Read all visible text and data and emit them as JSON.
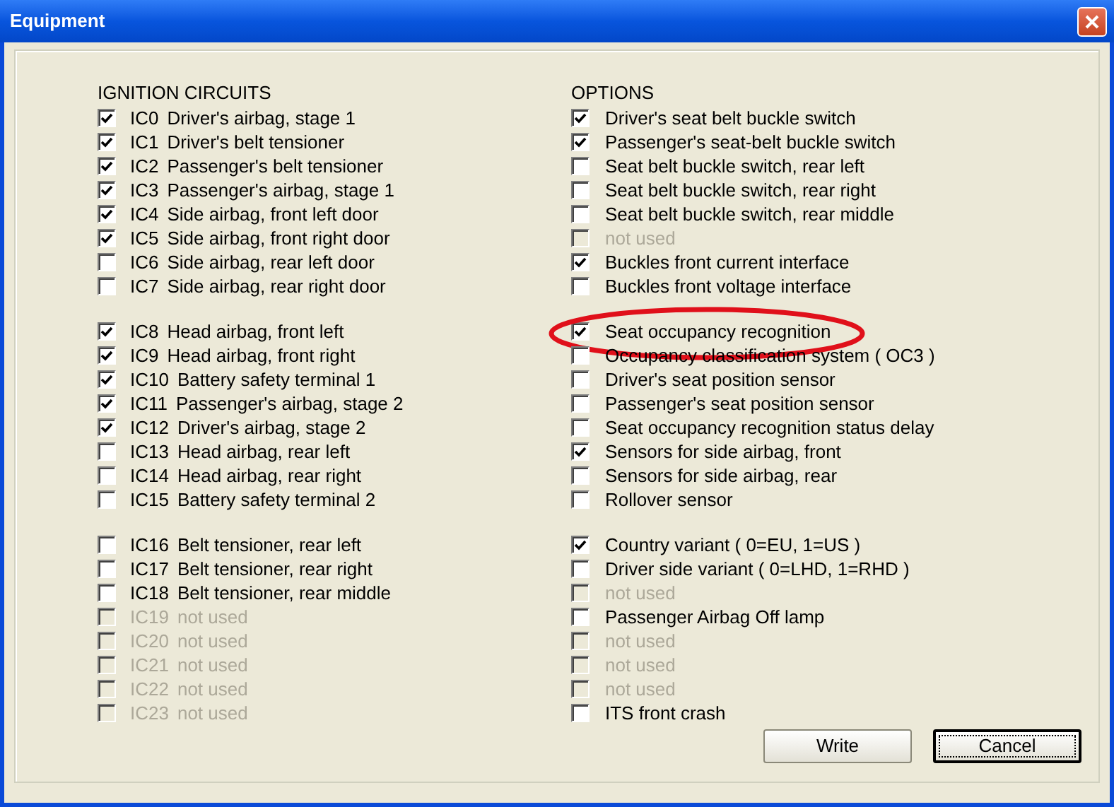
{
  "window": {
    "title": "Equipment"
  },
  "ignition_circuits": {
    "heading": "IGNITION  CIRCUITS",
    "groups": [
      [
        {
          "code": "IC0",
          "label": "Driver's airbag, stage 1",
          "checked": true,
          "disabled": false
        },
        {
          "code": "IC1",
          "label": "Driver's belt tensioner",
          "checked": true,
          "disabled": false
        },
        {
          "code": "IC2",
          "label": "Passenger's belt tensioner",
          "checked": true,
          "disabled": false
        },
        {
          "code": "IC3",
          "label": "Passenger's airbag, stage 1",
          "checked": true,
          "disabled": false
        },
        {
          "code": "IC4",
          "label": "Side airbag, front left door",
          "checked": true,
          "disabled": false
        },
        {
          "code": "IC5",
          "label": "Side airbag, front right door",
          "checked": true,
          "disabled": false
        },
        {
          "code": "IC6",
          "label": "Side airbag, rear left door",
          "checked": false,
          "disabled": false
        },
        {
          "code": "IC7",
          "label": "Side airbag, rear right door",
          "checked": false,
          "disabled": false
        }
      ],
      [
        {
          "code": "IC8",
          "label": "Head airbag, front left",
          "checked": true,
          "disabled": false
        },
        {
          "code": "IC9",
          "label": "Head airbag, front right",
          "checked": true,
          "disabled": false
        },
        {
          "code": "IC10",
          "label": "Battery safety terminal 1",
          "checked": true,
          "disabled": false
        },
        {
          "code": "IC11",
          "label": "Passenger's airbag, stage 2",
          "checked": true,
          "disabled": false
        },
        {
          "code": "IC12",
          "label": "Driver's airbag, stage 2",
          "checked": true,
          "disabled": false
        },
        {
          "code": "IC13",
          "label": "Head airbag, rear left",
          "checked": false,
          "disabled": false
        },
        {
          "code": "IC14",
          "label": "Head airbag, rear right",
          "checked": false,
          "disabled": false
        },
        {
          "code": "IC15",
          "label": "Battery safety terminal 2",
          "checked": false,
          "disabled": false
        }
      ],
      [
        {
          "code": "IC16",
          "label": "Belt tensioner, rear left",
          "checked": false,
          "disabled": false
        },
        {
          "code": "IC17",
          "label": "Belt tensioner, rear right",
          "checked": false,
          "disabled": false
        },
        {
          "code": "IC18",
          "label": "Belt tensioner, rear middle",
          "checked": false,
          "disabled": false
        },
        {
          "code": "IC19",
          "label": "not used",
          "checked": false,
          "disabled": true
        },
        {
          "code": "IC20",
          "label": "not used",
          "checked": false,
          "disabled": true
        },
        {
          "code": "IC21",
          "label": "not used",
          "checked": false,
          "disabled": true
        },
        {
          "code": "IC22",
          "label": "not used",
          "checked": false,
          "disabled": true
        },
        {
          "code": "IC23",
          "label": "not used",
          "checked": false,
          "disabled": true
        }
      ]
    ]
  },
  "options": {
    "heading": "OPTIONS",
    "groups": [
      [
        {
          "label": "Driver's seat belt buckle switch",
          "checked": true,
          "disabled": false,
          "highlighted": false
        },
        {
          "label": "Passenger's seat-belt buckle switch",
          "checked": true,
          "disabled": false,
          "highlighted": false
        },
        {
          "label": "Seat belt buckle switch, rear left",
          "checked": false,
          "disabled": false,
          "highlighted": false
        },
        {
          "label": "Seat belt buckle switch, rear right",
          "checked": false,
          "disabled": false,
          "highlighted": false
        },
        {
          "label": "Seat belt buckle switch, rear middle",
          "checked": false,
          "disabled": false,
          "highlighted": false
        },
        {
          "label": "not used",
          "checked": false,
          "disabled": true,
          "highlighted": false
        },
        {
          "label": "Buckles front current interface",
          "checked": true,
          "disabled": false,
          "highlighted": false
        },
        {
          "label": "Buckles front voltage interface",
          "checked": false,
          "disabled": false,
          "highlighted": false
        }
      ],
      [
        {
          "label": "Seat occupancy recognition",
          "checked": true,
          "disabled": false,
          "highlighted": true
        },
        {
          "label": "Occupancy classification system ( OC3 )",
          "checked": false,
          "disabled": false,
          "highlighted": false
        },
        {
          "label": "Driver's seat position sensor",
          "checked": false,
          "disabled": false,
          "highlighted": false
        },
        {
          "label": "Passenger's seat position sensor",
          "checked": false,
          "disabled": false,
          "highlighted": false
        },
        {
          "label": "Seat occupancy recognition status delay",
          "checked": false,
          "disabled": false,
          "highlighted": false
        },
        {
          "label": "Sensors for side airbag, front",
          "checked": true,
          "disabled": false,
          "highlighted": false
        },
        {
          "label": "Sensors for side airbag, rear",
          "checked": false,
          "disabled": false,
          "highlighted": false
        },
        {
          "label": "Rollover sensor",
          "checked": false,
          "disabled": false,
          "highlighted": false
        }
      ],
      [
        {
          "label": "Country variant ( 0=EU, 1=US )",
          "checked": true,
          "disabled": false,
          "highlighted": false
        },
        {
          "label": "Driver side variant ( 0=LHD, 1=RHD )",
          "checked": false,
          "disabled": false,
          "highlighted": false
        },
        {
          "label": "not used",
          "checked": false,
          "disabled": true,
          "highlighted": false
        },
        {
          "label": "Passenger Airbag Off lamp",
          "checked": false,
          "disabled": false,
          "highlighted": false
        },
        {
          "label": "not used",
          "checked": false,
          "disabled": true,
          "highlighted": false
        },
        {
          "label": "not used",
          "checked": false,
          "disabled": true,
          "highlighted": false
        },
        {
          "label": "not used",
          "checked": false,
          "disabled": true,
          "highlighted": false
        },
        {
          "label": "ITS front crash",
          "checked": false,
          "disabled": false,
          "highlighted": false
        }
      ]
    ]
  },
  "buttons": [
    {
      "label": "Write",
      "focused": false
    },
    {
      "label": "Cancel",
      "focused": true
    }
  ]
}
